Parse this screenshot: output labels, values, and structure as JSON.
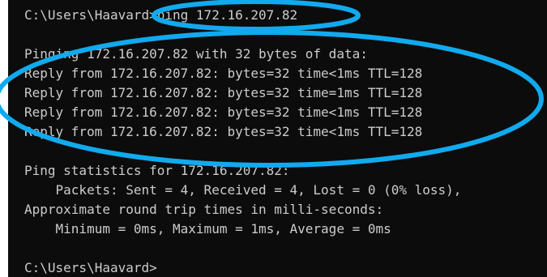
{
  "terminal": {
    "lines": [
      "C:\\Users\\Haavard>ping 172.16.207.82",
      "",
      "Pinging 172.16.207.82 with 32 bytes of data:",
      "Reply from 172.16.207.82: bytes=32 time<1ms TTL=128",
      "Reply from 172.16.207.82: bytes=32 time=1ms TTL=128",
      "Reply from 172.16.207.82: bytes=32 time<1ms TTL=128",
      "Reply from 172.16.207.82: bytes=32 time<1ms TTL=128",
      "",
      "Ping statistics for 172.16.207.82:",
      "    Packets: Sent = 4, Received = 4, Lost = 0 (0% loss),",
      "Approximate round trip times in milli-seconds:",
      "    Minimum = 0ms, Maximum = 1ms, Average = 0ms",
      "",
      "C:\\Users\\Haavard>"
    ]
  },
  "colors": {
    "terminal_background": "#0c0c0c",
    "terminal_text": "#cccccc",
    "annotation_stroke": "#11aaee"
  }
}
